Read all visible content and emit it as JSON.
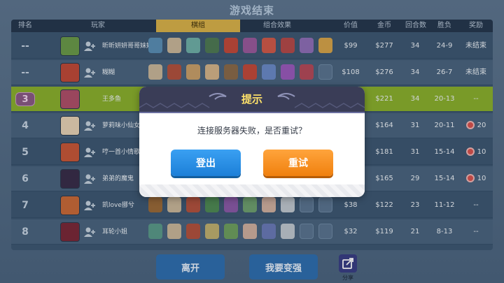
{
  "title": "游戏结束",
  "headers": {
    "rank": "排名",
    "player": "玩家",
    "lineup": "棋组",
    "combo": "组合效果",
    "price": "价值",
    "gold": "金币",
    "rounds": "回合数",
    "winloss": "胜负",
    "reward": "奖励"
  },
  "rows": [
    {
      "rank": "--",
      "name": "昕昕妍妍哥哥妹妹",
      "price": "$99",
      "gold": "$277",
      "rounds": "34",
      "wl": "24-9",
      "reward": "未结束"
    },
    {
      "rank": "--",
      "name": "糊糊",
      "price": "$108",
      "gold": "$276",
      "rounds": "34",
      "wl": "26-7",
      "reward": "未结束"
    },
    {
      "rank": "3",
      "name": "王多鱼",
      "price": "",
      "gold": "$221",
      "rounds": "34",
      "wl": "20-13",
      "reward": "--"
    },
    {
      "rank": "4",
      "name": "萝莉味小仙女",
      "price": "",
      "gold": "$164",
      "rounds": "31",
      "wl": "20-11",
      "reward": "20"
    },
    {
      "rank": "5",
      "name": "哼一首小情歌",
      "price": "",
      "gold": "$181",
      "rounds": "31",
      "wl": "15-14",
      "reward": "10"
    },
    {
      "rank": "6",
      "name": "弟弟的魔鬼",
      "price": "",
      "gold": "$165",
      "rounds": "29",
      "wl": "15-14",
      "reward": "10"
    },
    {
      "rank": "7",
      "name": "凯love挪兮",
      "price": "$38",
      "gold": "$122",
      "rounds": "23",
      "wl": "11-12",
      "reward": "--"
    },
    {
      "rank": "8",
      "name": "耳轮小姐",
      "price": "$32",
      "gold": "$119",
      "rounds": "21",
      "wl": "8-13",
      "reward": "--"
    }
  ],
  "dialog": {
    "title": "提示",
    "message": "连接服务器失败，是否重试？",
    "btn_logout": "登出",
    "btn_retry": "重试"
  },
  "bottom": {
    "leave": "离开",
    "stronger": "我要变强",
    "share": "分享"
  },
  "colors": {
    "highlight_row": "#8ab02e",
    "dialog_title": "#ffe26a",
    "button_blue": "#1c7fd8",
    "button_orange": "#f0800e"
  }
}
